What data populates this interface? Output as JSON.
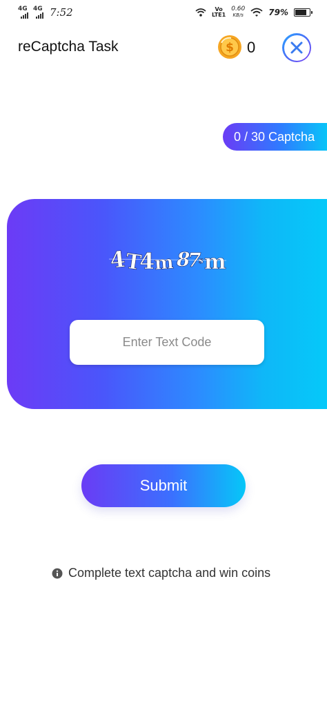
{
  "status_bar": {
    "network_1": "4G",
    "network_2": "4G",
    "time": "7:52",
    "volte_top": "Vo",
    "volte_bottom": "LTE1",
    "speed_value": "0.60",
    "speed_unit": "KB/s",
    "battery_percent": "79%",
    "battery_level": 0.79
  },
  "header": {
    "title": "reCaptcha Task",
    "coin_count": "0",
    "coin_symbol": "$",
    "coin_color": "#f4a21c"
  },
  "progress": {
    "label": "0 / 30 Captcha"
  },
  "captcha": {
    "image_text": "4T4m87sm",
    "input_placeholder": "Enter Text Code",
    "input_value": ""
  },
  "submit": {
    "label": "Submit"
  },
  "hint": {
    "icon": "info-icon",
    "text": "Complete text captcha and win coins"
  },
  "colors": {
    "gradient_start": "#6a3cf5",
    "gradient_mid": "#2f7bff",
    "gradient_end": "#06c7f8"
  }
}
